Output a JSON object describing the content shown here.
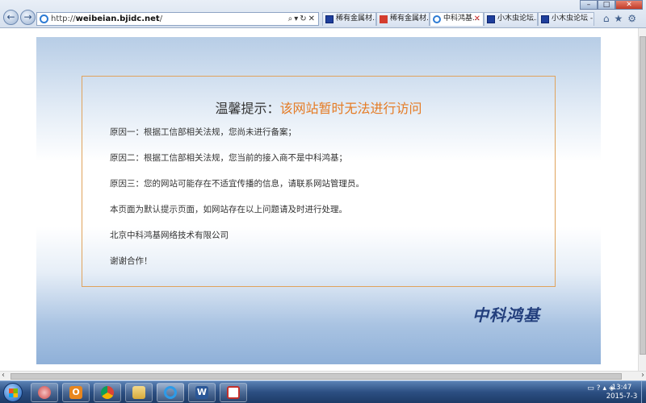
{
  "browser": {
    "address_url_prefix": "http://",
    "address_url_domain": "weibeian.bjidc.net",
    "address_url_suffix": "/",
    "tabs": [
      {
        "label": "稀有金属材..."
      },
      {
        "label": "稀有金属材..."
      },
      {
        "label": "中科鸿基..."
      },
      {
        "label": "小木虫论坛..."
      },
      {
        "label": "小木虫论坛 -..."
      }
    ]
  },
  "page": {
    "title_prefix": "温馨提示：",
    "title_highlight": "该网站暂时无法进行访问",
    "lines": [
      "原因一：根据工信部相关法规，您尚未进行备案；",
      "原因二：根据工信部相关法规，您当前的接入商不是中科鸿基；",
      "原因三：您的网站可能存在不适宜传播的信息，请联系网站管理员。",
      "本页面为默认提示页面，如网站存在以上问题请及时进行处理。",
      "北京中科鸿基网络技术有限公司",
      "谢谢合作！"
    ],
    "logo_text": "中科鸿基"
  },
  "taskbar": {
    "apps": [
      {
        "icon": "browser-icon"
      },
      {
        "icon": "outlook-icon",
        "label": "O"
      },
      {
        "icon": "chrome-icon"
      },
      {
        "icon": "folder-icon"
      },
      {
        "icon": "ie-icon"
      },
      {
        "icon": "word-icon",
        "label": "W"
      },
      {
        "icon": "pdf-icon"
      }
    ],
    "time": "13:47",
    "date": "2015-7-3"
  },
  "colors": {
    "accent_orange": "#e57b24",
    "logo_blue": "#233f7d",
    "border_orange": "#e0a35c"
  }
}
